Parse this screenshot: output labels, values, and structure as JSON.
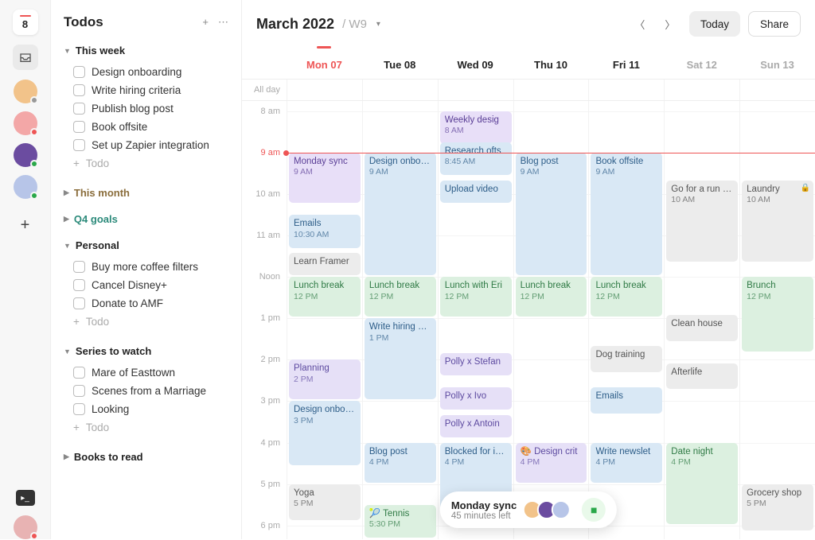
{
  "rail": {
    "date": "8",
    "avatars": [
      {
        "bg": "#f2c38a",
        "dot": "#999"
      },
      {
        "bg": "#f3a7a7",
        "dot": "#e55"
      },
      {
        "bg": "#6b4ca0",
        "dot": "#2aa84a"
      },
      {
        "bg": "#b7c5e8",
        "dot": "#2aa84a"
      }
    ]
  },
  "sidebar": {
    "title": "Todos",
    "sections": [
      {
        "label": "This week",
        "expanded": true,
        "color": "",
        "items": [
          "Design onboarding",
          "Write hiring criteria",
          "Publish blog post",
          "Book offsite",
          "Set up Zapier integration"
        ],
        "add": true
      },
      {
        "label": "This month",
        "expanded": false,
        "color": "brown",
        "items": [],
        "add": false
      },
      {
        "label": "Q4 goals",
        "expanded": false,
        "color": "teal",
        "items": [],
        "add": false
      },
      {
        "label": "Personal",
        "expanded": true,
        "color": "",
        "items": [
          "Buy more coffee filters",
          "Cancel Disney+",
          "Donate to AMF"
        ],
        "add": true
      },
      {
        "label": "Series to watch",
        "expanded": true,
        "color": "",
        "items": [
          "Mare of Easttown",
          "Scenes from a Marriage",
          "Looking"
        ],
        "add": true
      },
      {
        "label": "Books to read",
        "expanded": false,
        "color": "",
        "items": [],
        "add": false
      }
    ],
    "add_label": "Todo"
  },
  "header": {
    "month": "March 2022",
    "week": "W9",
    "today": "Today",
    "share": "Share"
  },
  "days": [
    {
      "label": "Mon 07",
      "active": true
    },
    {
      "label": "Tue 08"
    },
    {
      "label": "Wed 09"
    },
    {
      "label": "Thu 10"
    },
    {
      "label": "Fri 11"
    },
    {
      "label": "Sat 12",
      "weekend": true
    },
    {
      "label": "Sun 13",
      "weekend": true
    }
  ],
  "allday_label": "All day",
  "hours": [
    {
      "label": "8 am",
      "min": 480
    },
    {
      "label": "9 am",
      "min": 540,
      "now": true
    },
    {
      "label": "10 am",
      "min": 600
    },
    {
      "label": "11 am",
      "min": 660
    },
    {
      "label": "Noon",
      "min": 720
    },
    {
      "label": "1 pm",
      "min": 780
    },
    {
      "label": "2 pm",
      "min": 840
    },
    {
      "label": "3 pm",
      "min": 900
    },
    {
      "label": "4 pm",
      "min": 960
    },
    {
      "label": "5 pm",
      "min": 1020
    },
    {
      "label": "6 pm",
      "min": 1080
    }
  ],
  "grid": {
    "start_min": 465,
    "end_min": 1100,
    "now_min": 540
  },
  "events": [
    {
      "day": 0,
      "title": "Monday sync",
      "time": "9 AM",
      "start": 540,
      "end": 615,
      "color": "c-purple"
    },
    {
      "day": 0,
      "title": "Emails",
      "time": "10:30 AM",
      "start": 630,
      "end": 680,
      "color": "c-blue"
    },
    {
      "day": 0,
      "title": "Learn Framer",
      "time": "",
      "start": 685,
      "end": 720,
      "color": "c-grey"
    },
    {
      "day": 0,
      "title": "Lunch break",
      "time": "12 PM",
      "start": 720,
      "end": 780,
      "color": "c-green"
    },
    {
      "day": 0,
      "title": "Planning",
      "time": "2 PM",
      "start": 840,
      "end": 900,
      "color": "c-lav"
    },
    {
      "day": 0,
      "title": "Design onboarding",
      "time": "3 PM",
      "start": 900,
      "end": 995,
      "color": "c-blue"
    },
    {
      "day": 0,
      "title": "Yoga",
      "time": "5 PM",
      "start": 1020,
      "end": 1075,
      "color": "c-grey"
    },
    {
      "day": 1,
      "title": "Design onboarding",
      "time": "9 AM",
      "start": 540,
      "end": 720,
      "color": "c-blue"
    },
    {
      "day": 1,
      "title": "Lunch break",
      "time": "12 PM",
      "start": 720,
      "end": 780,
      "color": "c-green"
    },
    {
      "day": 1,
      "title": "Write hiring criteria",
      "time": "1 PM",
      "start": 780,
      "end": 900,
      "color": "c-blue"
    },
    {
      "day": 1,
      "title": "Blog post",
      "time": "4 PM",
      "start": 960,
      "end": 1020,
      "color": "c-blue"
    },
    {
      "day": 1,
      "title": "🎾 Tennis",
      "time": "5:30 PM",
      "start": 1050,
      "end": 1100,
      "color": "c-green"
    },
    {
      "day": 2,
      "title": "Weekly desig",
      "time": "8 AM",
      "start": 480,
      "end": 530,
      "color": "c-purple"
    },
    {
      "day": 2,
      "title": "Research ofts",
      "time": "8:45 AM",
      "start": 525,
      "end": 575,
      "color": "c-blue"
    },
    {
      "day": 2,
      "title": "Upload video",
      "time": "",
      "start": 580,
      "end": 615,
      "color": "c-blue"
    },
    {
      "day": 2,
      "title": "Lunch with Eri",
      "time": "12 PM",
      "start": 720,
      "end": 780,
      "color": "c-green"
    },
    {
      "day": 2,
      "title": "Polly x Stefan",
      "time": "",
      "start": 830,
      "end": 865,
      "color": "c-lav"
    },
    {
      "day": 2,
      "title": "Polly x Ivo",
      "time": "",
      "start": 880,
      "end": 915,
      "color": "c-lav"
    },
    {
      "day": 2,
      "title": "Polly x Antoin",
      "time": "",
      "start": 920,
      "end": 955,
      "color": "c-lav"
    },
    {
      "day": 2,
      "title": "Blocked for interview",
      "time": "4 PM",
      "start": 960,
      "end": 1060,
      "color": "c-blue"
    },
    {
      "day": 3,
      "title": "Blog post",
      "time": "9 AM",
      "start": 540,
      "end": 720,
      "color": "c-blue"
    },
    {
      "day": 3,
      "title": "Lunch break",
      "time": "12 PM",
      "start": 720,
      "end": 780,
      "color": "c-green"
    },
    {
      "day": 3,
      "title": "🎨 Design crit",
      "time": "4 PM",
      "start": 960,
      "end": 1020,
      "color": "c-lav"
    },
    {
      "day": 4,
      "title": "Book offsite",
      "time": "9 AM",
      "start": 540,
      "end": 720,
      "color": "c-blue"
    },
    {
      "day": 4,
      "title": "Lunch break",
      "time": "12 PM",
      "start": 720,
      "end": 780,
      "color": "c-green"
    },
    {
      "day": 4,
      "title": "Dog training",
      "time": "",
      "start": 820,
      "end": 860,
      "color": "c-grey"
    },
    {
      "day": 4,
      "title": "Emails",
      "time": "",
      "start": 880,
      "end": 920,
      "color": "c-blue"
    },
    {
      "day": 4,
      "title": "Write newslet",
      "time": "4 PM",
      "start": 960,
      "end": 1020,
      "color": "c-blue"
    },
    {
      "day": 5,
      "title": "Go for a run with Nikita",
      "time": "10 AM",
      "start": 580,
      "end": 700,
      "color": "c-grey"
    },
    {
      "day": 5,
      "title": "Clean house",
      "time": "",
      "start": 775,
      "end": 815,
      "color": "c-grey"
    },
    {
      "day": 5,
      "title": "Afterlife",
      "time": "",
      "start": 845,
      "end": 885,
      "color": "c-grey"
    },
    {
      "day": 5,
      "title": "Date night",
      "time": "4 PM",
      "start": 960,
      "end": 1080,
      "color": "c-green"
    },
    {
      "day": 6,
      "title": "Laundry",
      "time": "10 AM",
      "start": 580,
      "end": 700,
      "color": "c-grey",
      "locked": true
    },
    {
      "day": 6,
      "title": "Brunch",
      "time": "12 PM",
      "start": 720,
      "end": 830,
      "color": "c-green"
    },
    {
      "day": 6,
      "title": "Grocery shop",
      "time": "5 PM",
      "start": 1020,
      "end": 1090,
      "color": "c-grey"
    }
  ],
  "toast": {
    "title": "Monday sync",
    "sub": "45 minutes left",
    "avs": [
      "#f2c38a",
      "#6b4ca0",
      "#b7c5e8"
    ]
  }
}
